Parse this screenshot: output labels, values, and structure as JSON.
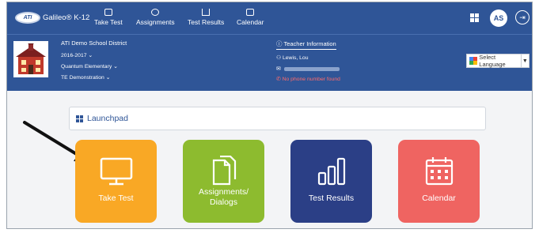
{
  "nav": {
    "logo_badge": "ATI",
    "brand": "Galileo® K-12",
    "items": [
      {
        "label": "Take Test",
        "icon": "monitor-icon"
      },
      {
        "label": "Assignments",
        "icon": "document-icon"
      },
      {
        "label": "Test Results",
        "icon": "bar-chart-icon"
      },
      {
        "label": "Calendar",
        "icon": "calendar-icon"
      }
    ],
    "user_initials": "AS"
  },
  "district": {
    "name": "ATI Demo School District",
    "year": "2016-2017 ⌄",
    "school": "Quantum Elementary ⌄",
    "demo": "TE Demonstration ⌄"
  },
  "teacher": {
    "heading": "ⓘ Teacher Information",
    "name": "Lewis, Lou",
    "phone": "No phone number found"
  },
  "language": {
    "label": "Select Language",
    "arrow": "▼"
  },
  "launchpad": {
    "label": "Launchpad"
  },
  "tiles": [
    {
      "label": "Take Test",
      "color": "#f9a825"
    },
    {
      "label_line1": "Assignments/",
      "label_line2": "Dialogs",
      "color": "#8dbb2f"
    },
    {
      "label": "Test Results",
      "color": "#2b3f86"
    },
    {
      "label": "Calendar",
      "color": "#ef6461"
    }
  ]
}
